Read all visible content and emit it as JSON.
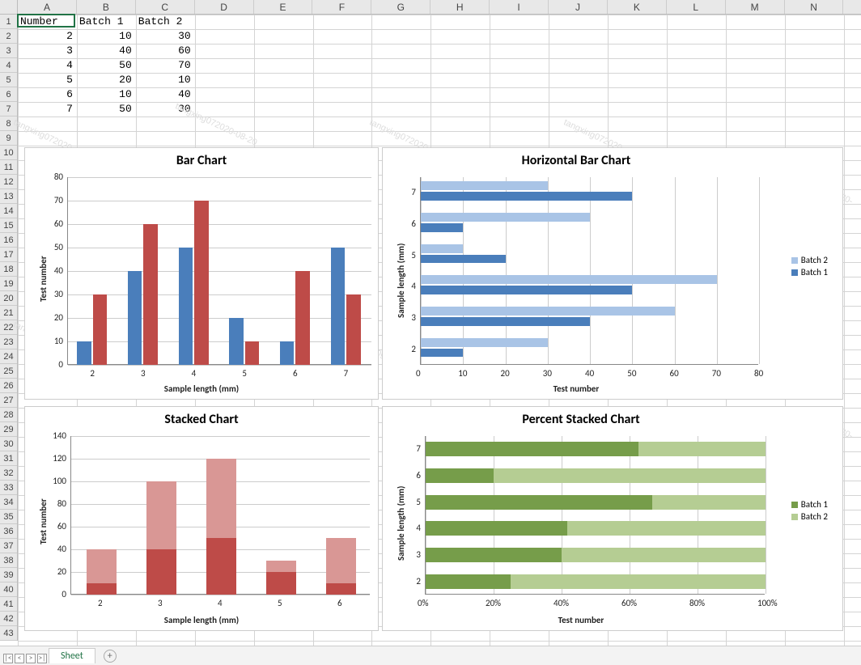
{
  "columns": [
    "A",
    "B",
    "C",
    "D",
    "E",
    "F",
    "G",
    "H",
    "I",
    "J",
    "K",
    "L",
    "M",
    "N"
  ],
  "row_count": 43,
  "active_cell": "A1",
  "table": {
    "headers": [
      "Number",
      "Batch 1",
      "Batch 2"
    ],
    "rows": [
      [
        2,
        10,
        30
      ],
      [
        3,
        40,
        60
      ],
      [
        4,
        50,
        70
      ],
      [
        5,
        20,
        10
      ],
      [
        6,
        10,
        40
      ],
      [
        7,
        50,
        30
      ]
    ]
  },
  "sheet_tab": "Sheet",
  "chart_data": [
    {
      "id": "bar",
      "type": "bar",
      "title": "Bar Chart",
      "xlabel": "Sample length (mm)",
      "ylabel": "Test number",
      "categories": [
        2,
        3,
        4,
        5,
        6,
        7
      ],
      "series": [
        {
          "name": "Batch 1",
          "values": [
            10,
            40,
            50,
            20,
            10,
            50
          ],
          "color": "#4a7ebb"
        },
        {
          "name": "Batch 2",
          "values": [
            30,
            60,
            70,
            10,
            40,
            30
          ],
          "color": "#be4b48"
        }
      ],
      "ylim": [
        0,
        80
      ],
      "ystep": 10
    },
    {
      "id": "hbar",
      "type": "hbar",
      "title": "Horizontal Bar Chart",
      "xlabel": "Test number",
      "ylabel": "Sample length (mm)",
      "categories": [
        2,
        3,
        4,
        5,
        6,
        7
      ],
      "series": [
        {
          "name": "Batch 2",
          "values": [
            30,
            60,
            70,
            10,
            40,
            30
          ],
          "color": "#a9c4e6"
        },
        {
          "name": "Batch 1",
          "values": [
            10,
            40,
            50,
            20,
            10,
            50
          ],
          "color": "#4a7ebb"
        }
      ],
      "xlim": [
        0,
        80
      ],
      "xstep": 10,
      "legend": [
        "Batch 2",
        "Batch 1"
      ]
    },
    {
      "id": "stacked",
      "type": "stacked-bar",
      "title": "Stacked Chart",
      "xlabel": "Sample length (mm)",
      "ylabel": "Test number",
      "categories": [
        2,
        3,
        4,
        5,
        6
      ],
      "series": [
        {
          "name": "Batch 1",
          "values": [
            10,
            40,
            50,
            20,
            10
          ],
          "color": "#be4b48"
        },
        {
          "name": "Batch 2",
          "values": [
            30,
            60,
            70,
            10,
            40
          ],
          "color": "#d99795"
        }
      ],
      "ylim": [
        0,
        140
      ],
      "ystep": 20
    },
    {
      "id": "pstacked",
      "type": "percent-stacked-hbar",
      "title": "Percent Stacked Chart",
      "xlabel": "Test number",
      "ylabel": "Sample length (mm)",
      "categories": [
        2,
        3,
        4,
        5,
        6,
        7
      ],
      "series": [
        {
          "name": "Batch 1",
          "values": [
            10,
            40,
            50,
            20,
            10,
            50
          ],
          "color": "#769d4a"
        },
        {
          "name": "Batch 2",
          "values": [
            30,
            60,
            70,
            10,
            40,
            30
          ],
          "color": "#b5cd93"
        }
      ],
      "xlim": [
        0,
        100
      ],
      "xstep": 20,
      "legend": [
        "Batch 1",
        "Batch 2"
      ]
    }
  ]
}
